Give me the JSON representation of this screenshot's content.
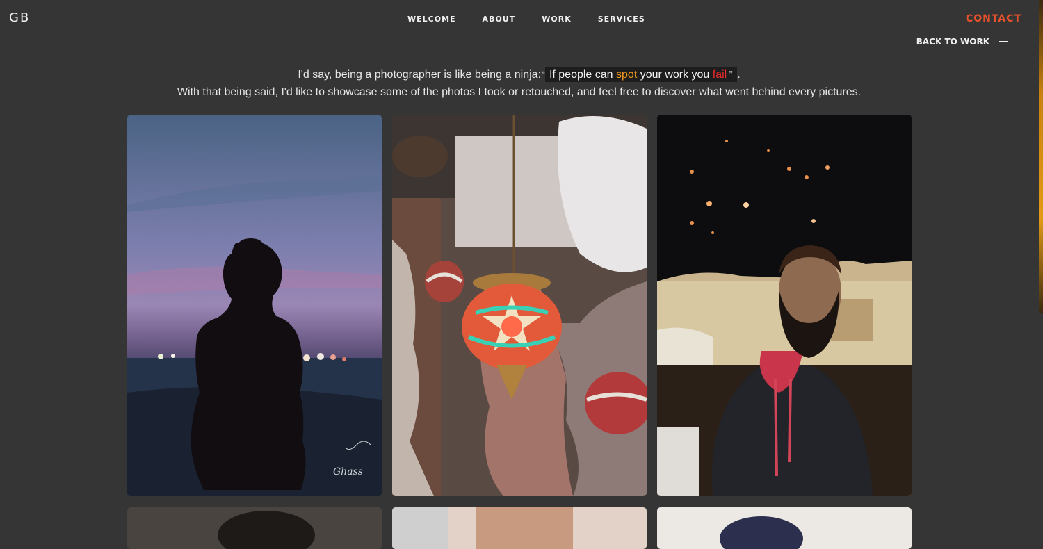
{
  "header": {
    "logo": "GB",
    "nav": [
      "WELCOME",
      "ABOUT",
      "WORK",
      "SERVICES"
    ],
    "contact": "CONTACT",
    "back_label": "BACK TO WORK"
  },
  "intro": {
    "line1_lead": "I'd say, being a photographer is like being a ninja:",
    "quote_a": "If people can ",
    "quote_spot": "spot",
    "quote_b": " your work you ",
    "quote_fail": "fail",
    "line1_end": ".",
    "line2": "With that being said, I'd like to showcase some of the photos I took or retouched, and feel free to discover what went behind every pictures."
  },
  "colors": {
    "accent": "#e8522b",
    "spot": "#f59a1a",
    "fail": "#ee2a2a",
    "background": "#353535"
  },
  "photos": [
    {
      "name": "woman-silhouette-sunset-photo",
      "signature": "Ghass"
    },
    {
      "name": "mosaic-lanterns-photo"
    },
    {
      "name": "bearded-man-night-lanterns-photo"
    }
  ]
}
